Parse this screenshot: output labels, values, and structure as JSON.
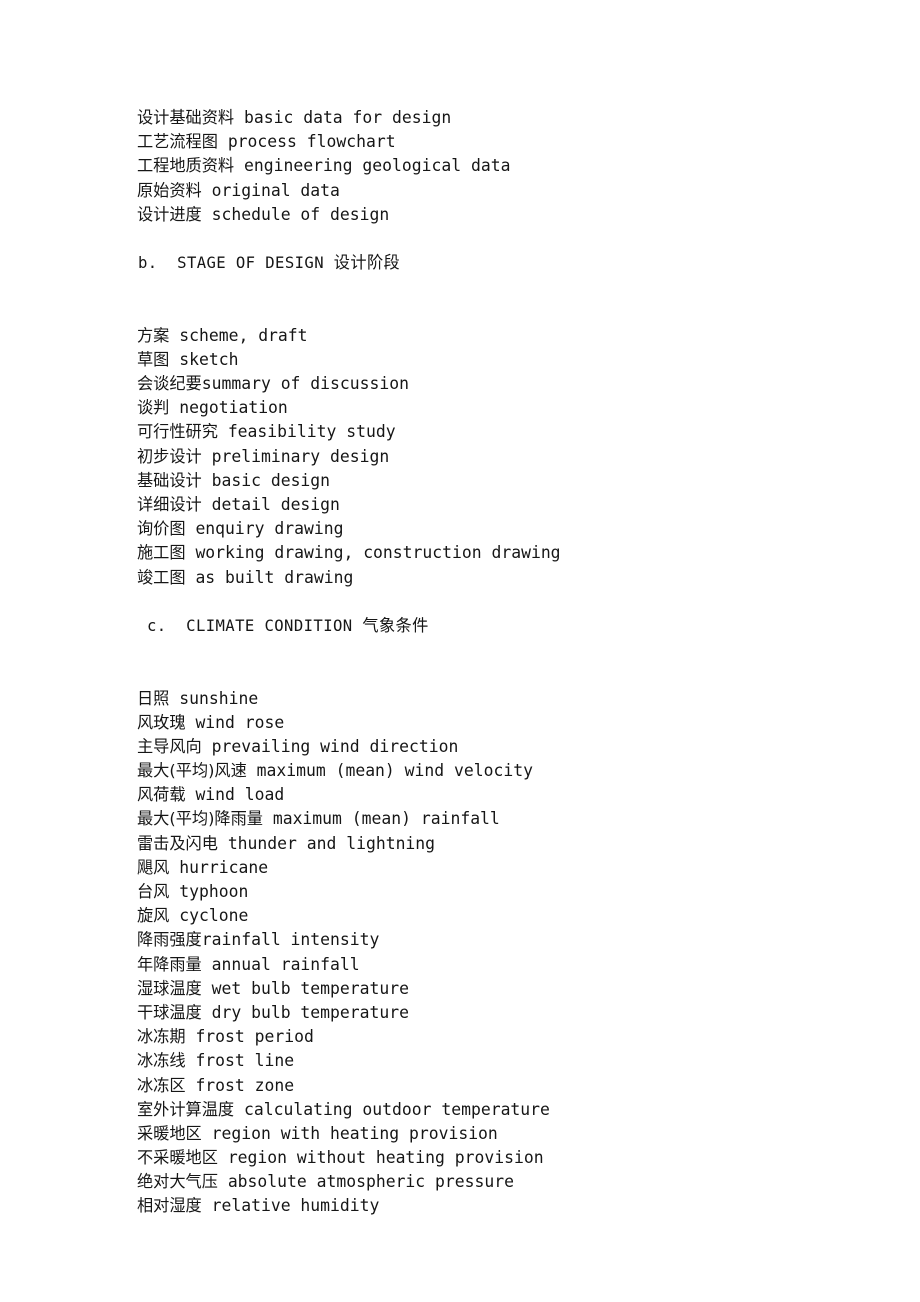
{
  "document": {
    "background_color": "#ffffff",
    "text_color": "#161616",
    "blocks": [
      {
        "id": "block-a-continued",
        "type": "entry-list",
        "lines": [
          {
            "cjk": "设计基础资料",
            "gap": " ",
            "en": "basic data for design"
          },
          {
            "cjk": "工艺流程图",
            "gap": " ",
            "en": "process flowchart"
          },
          {
            "cjk": "工程地质资料",
            "gap": " ",
            "en": "engineering geological data"
          },
          {
            "cjk": "原始资料",
            "gap": " ",
            "en": "original data"
          },
          {
            "cjk": "设计进度",
            "gap": " ",
            "en": "schedule of design"
          }
        ]
      },
      {
        "id": "section-b",
        "type": "section-heading",
        "indent": "b",
        "label": "b.",
        "title_en": "STAGE OF DESIGN",
        "title_cjk": "设计阶段"
      },
      {
        "id": "block-b",
        "type": "entry-list",
        "lines": [
          {
            "cjk": "方案",
            "gap": " ",
            "en": "scheme, draft"
          },
          {
            "cjk": "草图",
            "gap": " ",
            "en": "sketch"
          },
          {
            "cjk": "会谈纪要",
            "gap": "",
            "en": "summary of discussion"
          },
          {
            "cjk": "谈判",
            "gap": " ",
            "en": "negotiation"
          },
          {
            "cjk": "可行性研究",
            "gap": " ",
            "en": "feasibility study"
          },
          {
            "cjk": "初步设计",
            "gap": " ",
            "en": "preliminary design"
          },
          {
            "cjk": "基础设计",
            "gap": " ",
            "en": "basic design"
          },
          {
            "cjk": "详细设计",
            "gap": " ",
            "en": "detail design"
          },
          {
            "cjk": "询价图",
            "gap": " ",
            "en": "enquiry drawing"
          },
          {
            "cjk": "施工图",
            "gap": " ",
            "en": "working drawing, construction drawing"
          },
          {
            "cjk": "竣工图",
            "gap": " ",
            "en": "as built drawing"
          }
        ]
      },
      {
        "id": "section-c",
        "type": "section-heading",
        "indent": "c",
        "label": "c.",
        "title_en": "CLIMATE CONDITION",
        "title_cjk": "气象条件"
      },
      {
        "id": "block-c",
        "type": "entry-list",
        "lines": [
          {
            "cjk": "日照",
            "gap": " ",
            "en": "sunshine"
          },
          {
            "cjk": "风玫瑰",
            "gap": " ",
            "en": "wind rose"
          },
          {
            "cjk": "主导风向",
            "gap": " ",
            "en": "prevailing wind direction"
          },
          {
            "cjk": "最大(平均)风速",
            "gap": " ",
            "en": "maximum (mean) wind velocity"
          },
          {
            "cjk": "风荷载",
            "gap": " ",
            "en": "wind load"
          },
          {
            "cjk": "最大(平均)降雨量",
            "gap": " ",
            "en": "maximum (mean) rainfall"
          },
          {
            "cjk": "雷击及闪电",
            "gap": " ",
            "en": "thunder and lightning"
          },
          {
            "cjk": "飓风",
            "gap": " ",
            "en": "hurricane"
          },
          {
            "cjk": "台风",
            "gap": " ",
            "en": "typhoon"
          },
          {
            "cjk": "旋风",
            "gap": " ",
            "en": "cyclone"
          },
          {
            "cjk": "降雨强度",
            "gap": "",
            "en": "rainfall intensity"
          },
          {
            "cjk": "年降雨量",
            "gap": " ",
            "en": "annual rainfall"
          },
          {
            "cjk": "湿球温度",
            "gap": " ",
            "en": "wet bulb temperature"
          },
          {
            "cjk": "干球温度",
            "gap": " ",
            "en": "dry bulb temperature"
          },
          {
            "cjk": "冰冻期",
            "gap": " ",
            "en": "frost period"
          },
          {
            "cjk": "冰冻线",
            "gap": " ",
            "en": "frost line"
          },
          {
            "cjk": "冰冻区",
            "gap": " ",
            "en": "frost zone"
          },
          {
            "cjk": "室外计算温度",
            "gap": " ",
            "en": "calculating outdoor temperature"
          },
          {
            "cjk": "采暖地区",
            "gap": " ",
            "en": "region with heating provision"
          },
          {
            "cjk": "不采暖地区",
            "gap": " ",
            "en": "region without heating provision"
          },
          {
            "cjk": "绝对大气压",
            "gap": " ",
            "en": "absolute atmospheric pressure"
          },
          {
            "cjk": "相对湿度",
            "gap": " ",
            "en": "relative humidity"
          }
        ]
      }
    ]
  }
}
